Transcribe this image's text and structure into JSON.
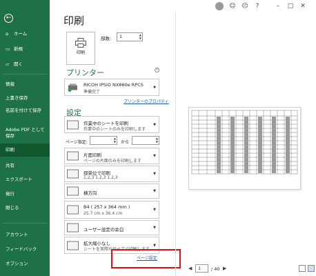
{
  "sidebar": {
    "items": [
      {
        "label": "ホーム",
        "icon": "home-icon"
      },
      {
        "label": "新規",
        "icon": "new-icon"
      },
      {
        "label": "開く",
        "icon": "folder-icon"
      },
      {
        "label": "情報"
      },
      {
        "label": "上書き保存"
      },
      {
        "label": "名前を付けて保存"
      },
      {
        "label": "Adobe PDF として保存"
      },
      {
        "label": "印刷"
      },
      {
        "label": "共有"
      },
      {
        "label": "エクスポート"
      },
      {
        "label": "発行"
      },
      {
        "label": "閉じる"
      },
      {
        "label": "アカウント"
      },
      {
        "label": "フィードバック"
      },
      {
        "label": "オプション"
      }
    ]
  },
  "title": "印刷",
  "print_button": {
    "label": "印刷"
  },
  "copies": {
    "label": "部数:",
    "value": "1"
  },
  "printer": {
    "heading": "プリンター",
    "name": "RICOH IPSiO NX860e RPCS",
    "status": "準備完了",
    "properties_link": "プリンターのプロパティ"
  },
  "settings": {
    "heading": "設定",
    "scope": {
      "title": "作業中のシートを印刷",
      "desc": "作業中のシートのみを印刷します"
    },
    "pages": {
      "label": "ページ指定:",
      "to": "から",
      "from_value": "",
      "to_value": ""
    },
    "sides": {
      "title": "片面印刷",
      "desc": "ページの片面のみを印刷します"
    },
    "collate": {
      "title": "部単位で印刷",
      "desc": "1,2,3    1,2,3    1,2,3"
    },
    "orientation": {
      "title": "横方向"
    },
    "paper": {
      "title": "B4 ( 257 x 364 mm )",
      "desc": "25.7 cm x 36.4 cm"
    },
    "margins": {
      "title": "ユーザー設定の余白"
    },
    "scaling": {
      "title": "拡大縮小なし",
      "desc": "シートを実際のサイズで印刷します"
    },
    "page_setup_link": "ページ設定"
  },
  "pager": {
    "current": "1",
    "total": "/ 40"
  },
  "colors": {
    "sidebar": "#1e7145",
    "active": "#10592f",
    "accent": "#1e7145",
    "highlight": "#e01010"
  }
}
